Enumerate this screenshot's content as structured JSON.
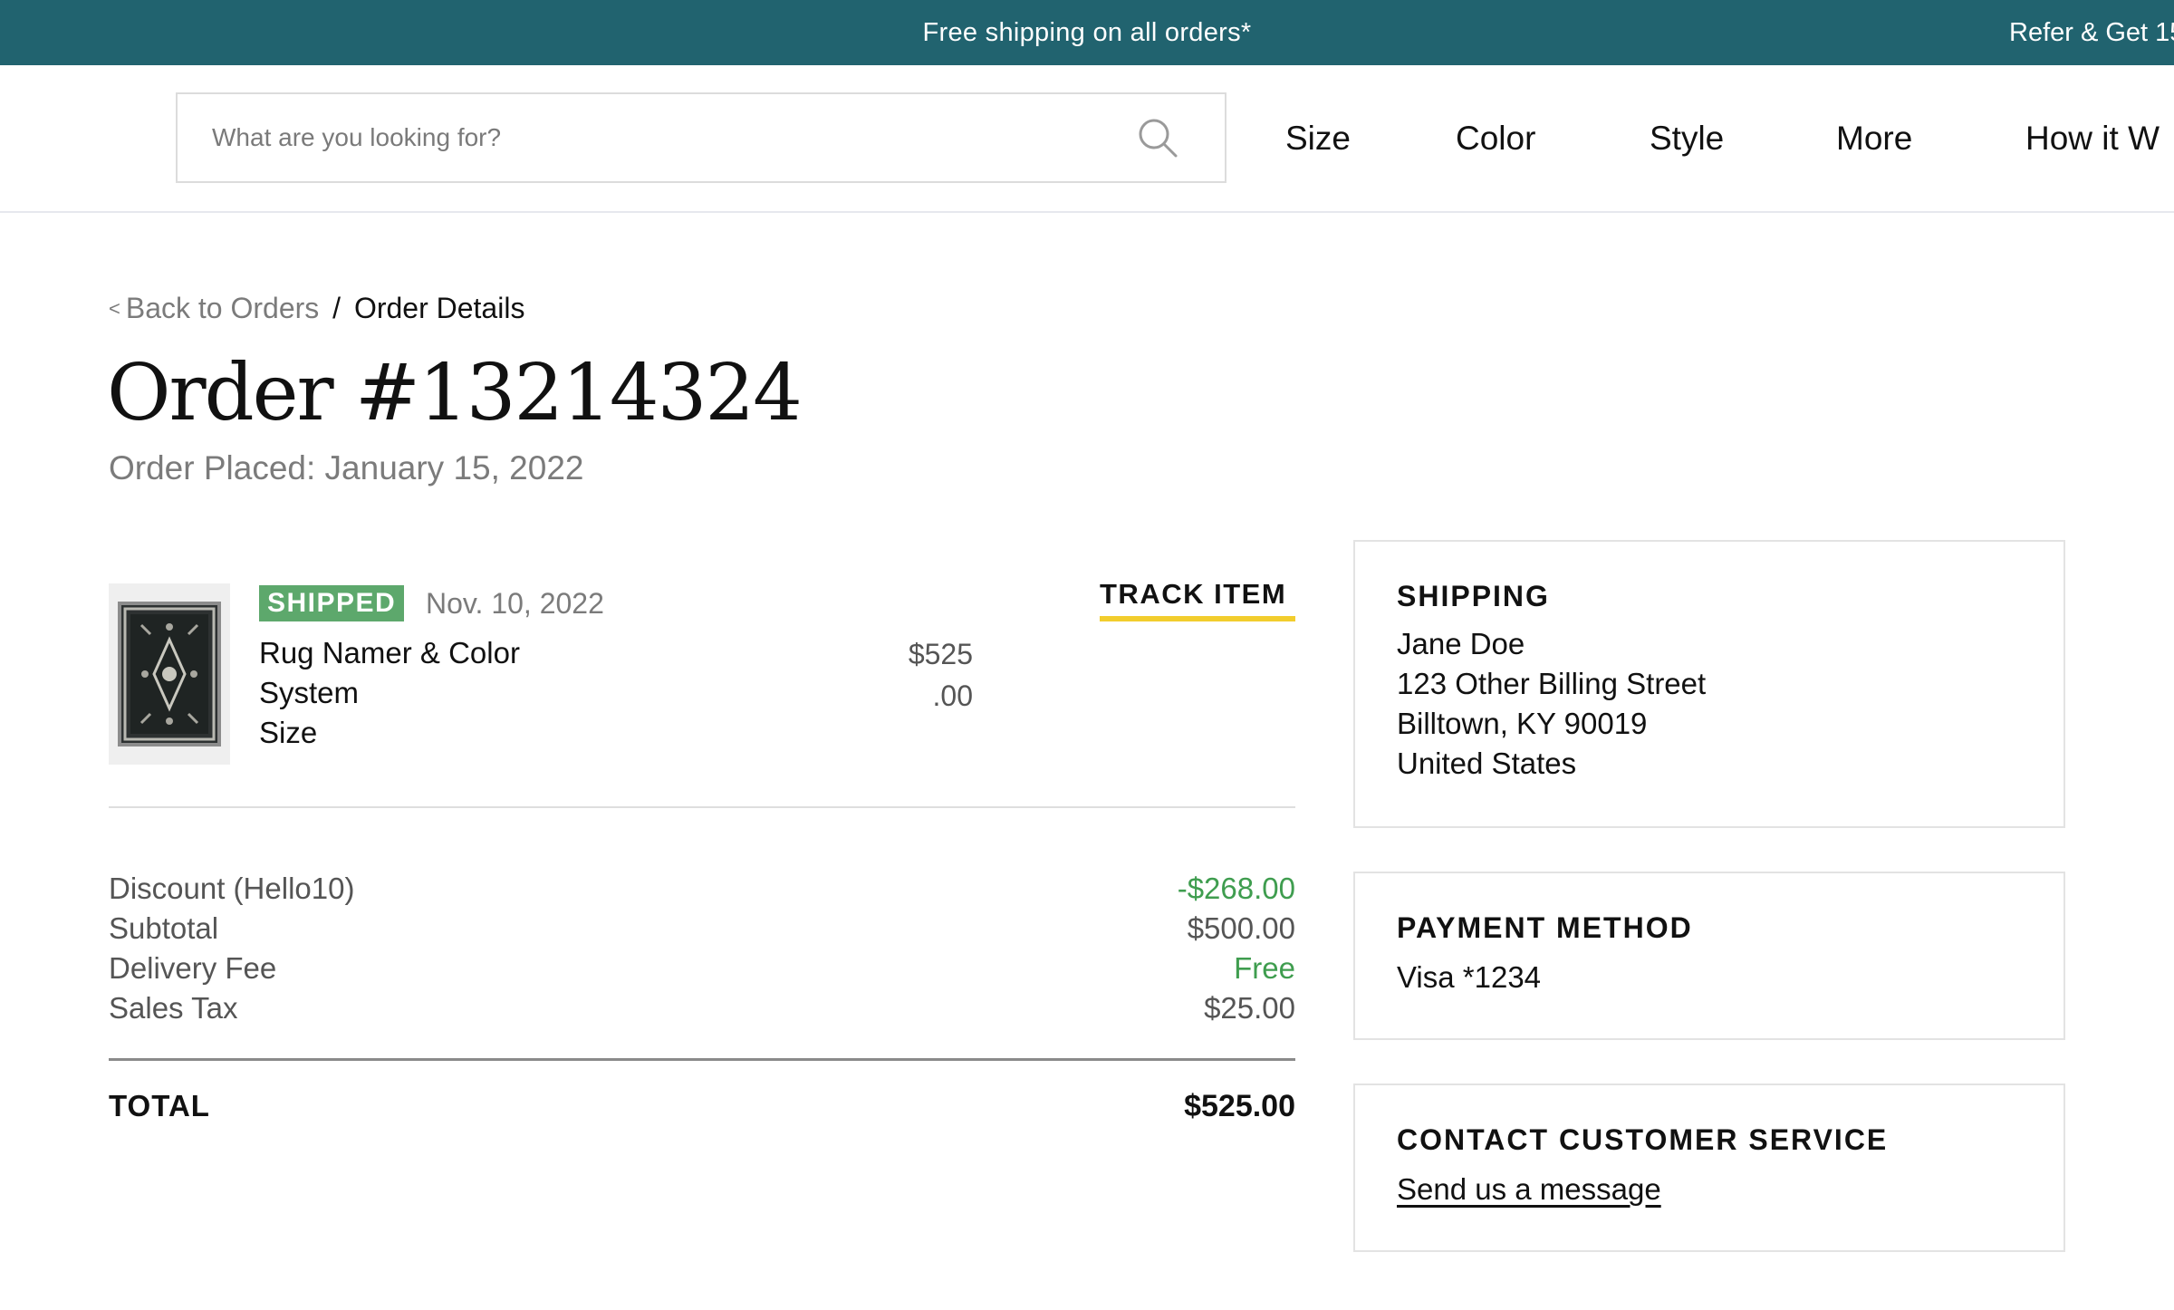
{
  "promo": {
    "center_text": "Free shipping on all orders*",
    "right_text": "Refer & Get 15"
  },
  "header": {
    "search_placeholder": "What are you looking for?",
    "nav": [
      "Size",
      "Color",
      "Style",
      "More",
      "How it W"
    ]
  },
  "breadcrumb": {
    "back_glyph": "<",
    "back_label": "Back to Orders",
    "separator": "/",
    "current": "Order Details"
  },
  "order": {
    "title": "Order #13214324",
    "placed": "Order Placed: January 15, 2022"
  },
  "item": {
    "status_badge": "SHIPPED",
    "status_date": "Nov. 10, 2022",
    "track_label": "TRACK ITEM",
    "name_lines": [
      "Rug Namer & Color",
      "System",
      "Size"
    ],
    "price_lines": [
      "$525",
      ".00"
    ]
  },
  "summary": {
    "rows": [
      {
        "label": "Discount (Hello10)",
        "value": "-$268.00",
        "color": "#3f9d4f"
      },
      {
        "label": "Subtotal",
        "value": "$500.00",
        "color": "#555555"
      },
      {
        "label": "Delivery Fee",
        "value": "Free",
        "color": "#3f9d4f"
      },
      {
        "label": "Sales Tax",
        "value": "$25.00",
        "color": "#555555"
      }
    ],
    "total_label": "TOTAL",
    "total_value": "$525.00"
  },
  "shipping": {
    "title": "SHIPPING",
    "lines": [
      "Jane Doe",
      "123 Other Billing Street",
      "Billtown, KY 90019",
      "United States"
    ]
  },
  "payment": {
    "title": "PAYMENT METHOD",
    "value": "Visa *1234"
  },
  "contact": {
    "title": "CONTACT CUSTOMER SERVICE",
    "link": "Send us a message"
  },
  "colors": {
    "promo_bg": "#21636f",
    "badge_bg": "#5da86c",
    "track_underline": "#f2cd2d",
    "positive_green": "#3f9d4f"
  },
  "icons": {
    "search": "search-icon",
    "rug": "rug-thumbnail"
  }
}
